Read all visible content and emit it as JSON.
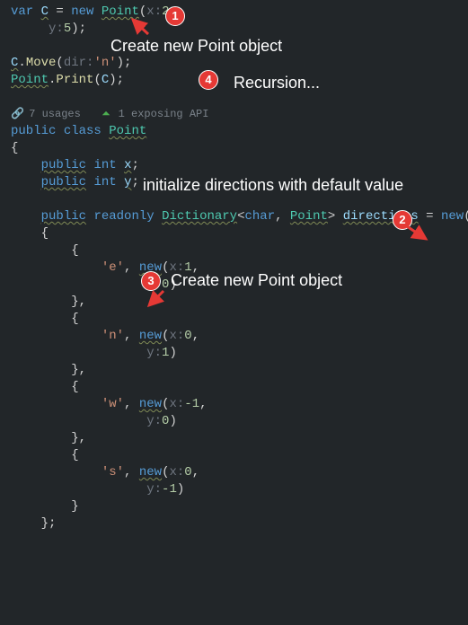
{
  "code": {
    "l1": {
      "var": "var",
      "C": "C",
      "eq": " = ",
      "new": "new",
      "Point": "Point",
      "p1": "x:",
      "v1": "2",
      "comma": ","
    },
    "l2": {
      "p2": "y:",
      "v2": "5",
      "end": ");"
    },
    "l3": "",
    "l4": {
      "C": "C",
      "dot": ".",
      "Move": "Move",
      "p": "dir:",
      "val": "'n'",
      "end": ");"
    },
    "l5": {
      "Point": "Point",
      "dot": ".",
      "Print": "Print",
      "arg": "C",
      "end": ");"
    },
    "usage": {
      "usages": "7 usages",
      "api": "1 exposing API"
    },
    "l6": {
      "pub": "public",
      "cls": "class",
      "Point": "Point"
    },
    "ob": "{",
    "l7": {
      "pub": "public",
      "int": "int",
      "x": "x",
      "semi": ";"
    },
    "l8": {
      "pub": "public",
      "int": "int",
      "y": "y",
      "semi": ";"
    },
    "l9": {
      "pub": "public",
      "ro": "readonly",
      "dict": "Dictionary",
      "lt": "<",
      "char": "char",
      "comma": ", ",
      "Point": "Point",
      "gt": ">",
      "dirs": "directions",
      "eq": " = ",
      "new": "new",
      "paren": "()"
    },
    "d_open": "{",
    "entries": [
      {
        "key": "'e'",
        "x": "1",
        "y": "0"
      },
      {
        "key": "'n'",
        "x": "0",
        "y": "1"
      },
      {
        "key": "'w'",
        "x": "-1",
        "y": "0"
      },
      {
        "key": "'s'",
        "x": "0",
        "y": "-1"
      }
    ],
    "new_kw": "new",
    "xh": "x:",
    "yh": "y:",
    "comma": ",",
    "cb": "}",
    "cbcomma": "},",
    "semi": ";"
  },
  "annotations": {
    "a1": "Create new Point object",
    "a2": "initialize directions with default value",
    "a3": "Create new Point object",
    "a4": "Recursion..."
  },
  "badges": {
    "b1": "1",
    "b2": "2",
    "b3": "3",
    "b4": "4"
  }
}
